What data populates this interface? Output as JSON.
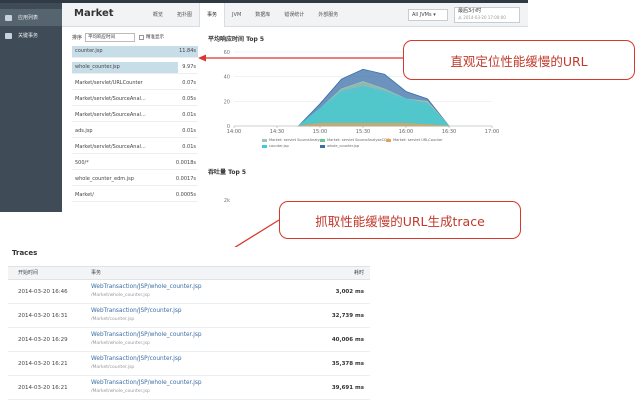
{
  "sidebar": {
    "items": [
      {
        "label": "应用列表",
        "icon": "list-icon"
      },
      {
        "label": "关键事务",
        "icon": "key-icon"
      }
    ]
  },
  "header": {
    "title": "Market",
    "tabs": [
      "概览",
      "拓扑图",
      "事务",
      "JVM",
      "数据库",
      "错误统计",
      "外部服务"
    ],
    "active_tab": "事务",
    "jvm_select": "All JVMs ▾",
    "time_range": {
      "label": "最后3小时",
      "detail": "从 2014-03-20 17:00:00"
    }
  },
  "url_panel": {
    "sort_label": "排序",
    "sort_value": "平均响应时间",
    "checkbox_label": "精准显示",
    "rows": [
      {
        "name": "counter.jsp",
        "value": "11.84s",
        "fill": 1.0
      },
      {
        "name": "whole_counter.jsp",
        "value": "9.97s",
        "fill": 0.84
      },
      {
        "name": "Market/servlet/URLCounter",
        "value": "0.07s",
        "fill": 0
      },
      {
        "name": "Market/servlet/SourceAnal...",
        "value": "0.05s",
        "fill": 0
      },
      {
        "name": "Market/servlet/SourceAnal...",
        "value": "0.01s",
        "fill": 0
      },
      {
        "name": "ads.jsp",
        "value": "0.01s",
        "fill": 0
      },
      {
        "name": "Market/servlet/SourceAnal...",
        "value": "0.01s",
        "fill": 0
      },
      {
        "name": "500/*",
        "value": "0.0018s",
        "fill": 0
      },
      {
        "name": "whole_counter_edm.jsp",
        "value": "0.0017s",
        "fill": 0
      },
      {
        "name": "Market/",
        "value": "0.0005s",
        "fill": 0
      }
    ]
  },
  "chart_data": [
    {
      "type": "area",
      "title": "平均响应时间 Top 5",
      "x": [
        "14:00",
        "14:30",
        "15:00",
        "15:30",
        "16:00",
        "16:30",
        "17:00"
      ],
      "ylim": [
        0,
        60
      ],
      "yticks": [
        0,
        20,
        40,
        60
      ],
      "series": [
        {
          "name": "Market: servlet SourceAnalyst",
          "color": "#9ac6ad",
          "points": [
            [
              14.75,
              0
            ],
            [
              15.0,
              14
            ],
            [
              15.25,
              30
            ],
            [
              15.5,
              36
            ],
            [
              15.75,
              30
            ],
            [
              16.0,
              22
            ],
            [
              16.25,
              20
            ],
            [
              16.5,
              0
            ]
          ]
        },
        {
          "name": "Market: servlet SourceAnalyseCDC",
          "color": "#6cc197",
          "points": [
            [
              14.75,
              0
            ],
            [
              15.0,
              12
            ],
            [
              15.25,
              25
            ],
            [
              15.5,
              30
            ],
            [
              15.75,
              26
            ],
            [
              16.0,
              18
            ],
            [
              16.25,
              16
            ],
            [
              16.5,
              0
            ]
          ]
        },
        {
          "name": "Market: servlet URLCounter",
          "color": "#e3a35a",
          "points": [
            [
              14.75,
              0
            ],
            [
              15.0,
              2
            ],
            [
              15.5,
              2
            ],
            [
              16.0,
              2
            ],
            [
              16.5,
              0
            ]
          ]
        },
        {
          "name": "counter.jsp",
          "color": "#45c8d9",
          "points": [
            [
              14.75,
              0
            ],
            [
              15.0,
              14
            ],
            [
              15.25,
              28
            ],
            [
              15.5,
              32
            ],
            [
              15.75,
              28
            ],
            [
              16.0,
              22
            ],
            [
              16.25,
              18
            ],
            [
              16.5,
              0
            ]
          ]
        },
        {
          "name": "whole_counter.jsp",
          "color": "#3a6fa8",
          "points": [
            [
              14.75,
              0
            ],
            [
              15.0,
              18
            ],
            [
              15.25,
              38
            ],
            [
              15.5,
              46
            ],
            [
              15.75,
              42
            ],
            [
              16.0,
              28
            ],
            [
              16.25,
              22
            ],
            [
              16.5,
              0
            ]
          ]
        }
      ]
    },
    {
      "type": "line",
      "title": "吞吐量 Top 5",
      "yticks": [
        "2k"
      ]
    }
  ],
  "callouts": {
    "first": "直观定位性能缓慢的URL",
    "second": "抓取性能缓慢的URL生成trace"
  },
  "traces": {
    "title": "Traces",
    "columns": {
      "start": "开始时间",
      "transaction": "事务",
      "duration": "耗时"
    },
    "rows": [
      {
        "start": "2014-03-20 16:46",
        "transaction": "WebTransaction/JSP/whole_counter.jsp",
        "path": "/Market/whole_counter.jsp",
        "duration": "3,002 ms"
      },
      {
        "start": "2014-03-20 16:31",
        "transaction": "WebTransaction/JSP/counter.jsp",
        "path": "/Market/counter.jsp",
        "duration": "32,739 ms"
      },
      {
        "start": "2014-03-20 16:29",
        "transaction": "WebTransaction/JSP/whole_counter.jsp",
        "path": "/Market/whole_counter.jsp",
        "duration": "40,006 ms"
      },
      {
        "start": "2014-03-20 16:21",
        "transaction": "WebTransaction/JSP/counter.jsp",
        "path": "/Market/counter.jsp",
        "duration": "35,378 ms"
      },
      {
        "start": "2014-03-20 16:21",
        "transaction": "WebTransaction/JSP/whole_counter.jsp",
        "path": "/Market/whole_counter.jsp",
        "duration": "39,691 ms"
      }
    ]
  }
}
